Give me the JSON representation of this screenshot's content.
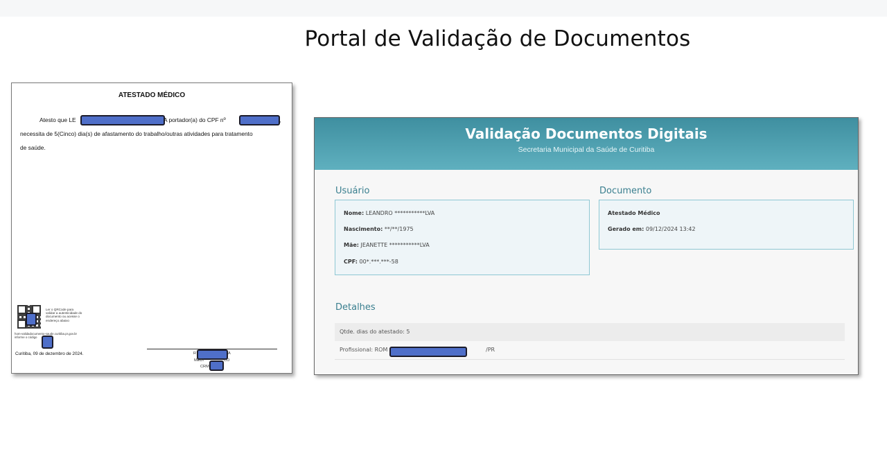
{
  "slide": {
    "title": "Portal de Validação de Documentos"
  },
  "certificate": {
    "title": "ATESTADO MÉDICO",
    "line1_start": "Atesto que LE",
    "line1_mid": "A portador(a) do CPF nº",
    "line1_end": ",",
    "line2": "necessita de 5(Cinco) dia(s) de afastamento do trabalho/outras atividades para tratamento",
    "line3": "de saúde.",
    "qr_instructions": "Ler o QRCode para validar a autenticidade do documento ou acesse o endereço abaixo",
    "url_line1": "hom-validadocumento-saude.curitiba.pr.gov.br",
    "url_line2": "informe o código",
    "date": "Curitiba, 09 de dezembro de 2024.",
    "sign_name_start": "R",
    "sign_name_end": "A",
    "sign_role_start": "MÉDI",
    "sign_role_end": "CO",
    "sign_crm": "CRM"
  },
  "portal": {
    "title": "Validação Documentos Digitais",
    "subtitle": "Secretaria Municipal da Saúde de Curitiba",
    "usuario": {
      "heading": "Usuário",
      "nome_label": "Nome:",
      "nome_value": "LEANDRO ***********LVA",
      "nascimento_label": "Nascimento:",
      "nascimento_value": "**/**/1975",
      "mae_label": "Mãe:",
      "mae_value": "JEANETTE ***********LVA",
      "cpf_label": "CPF:",
      "cpf_value": "00*.***.***-58"
    },
    "documento": {
      "heading": "Documento",
      "type": "Atestado Médico",
      "gerado_label": "Gerado em:",
      "gerado_value": "09/12/2024 13:42"
    },
    "detalhes": {
      "heading": "Detalhes",
      "qtde": "Qtde. dias do atestado: 5",
      "profissional_start": "Profissional: ROM",
      "profissional_end": "/PR"
    }
  },
  "colors": {
    "redaction": "#4f6fc9",
    "header_teal": "#4a9cad",
    "accent_text": "#3a7f8f"
  }
}
